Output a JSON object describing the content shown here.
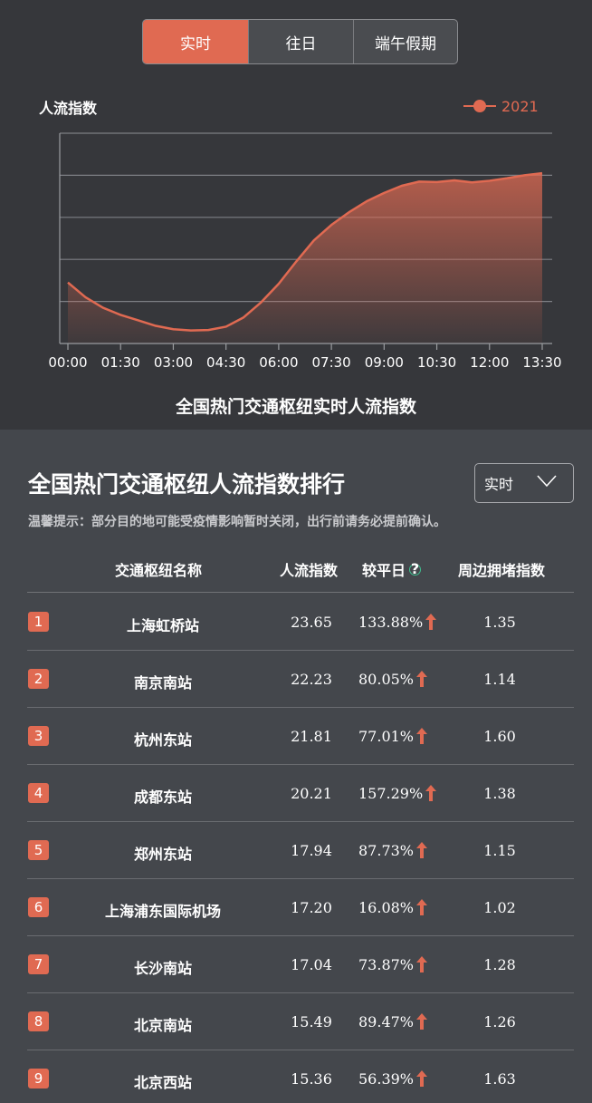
{
  "tabs": [
    {
      "label": "实时",
      "active": true
    },
    {
      "label": "往日",
      "active": false
    },
    {
      "label": "端午假期",
      "active": false
    }
  ],
  "chart_data": {
    "type": "area",
    "ylabel": "人流指数",
    "xlabel": "",
    "title": "全国热门交通枢纽实时人流指数",
    "legend": "top-right",
    "grid": true,
    "ylim": [
      0,
      5
    ],
    "series": [
      {
        "name": "2021",
        "color": "#e06a52",
        "x": [
          "00:00",
          "00:30",
          "01:00",
          "01:30",
          "02:00",
          "02:30",
          "03:00",
          "03:30",
          "04:00",
          "04:30",
          "05:00",
          "05:30",
          "06:00",
          "06:30",
          "07:00",
          "07:30",
          "08:00",
          "08:30",
          "09:00",
          "09:30",
          "10:00",
          "10:30",
          "11:00",
          "11:30",
          "12:00",
          "12:30",
          "13:00",
          "13:30"
        ],
        "values": [
          1.45,
          1.1,
          0.85,
          0.68,
          0.55,
          0.42,
          0.34,
          0.31,
          0.32,
          0.4,
          0.62,
          0.98,
          1.42,
          1.95,
          2.45,
          2.82,
          3.12,
          3.38,
          3.58,
          3.75,
          3.85,
          3.84,
          3.88,
          3.83,
          3.87,
          3.93,
          4.0,
          4.05
        ]
      }
    ],
    "xticks": [
      "00:00",
      "01:30",
      "03:00",
      "04:30",
      "06:00",
      "07:30",
      "09:00",
      "10:30",
      "12:00",
      "13:30"
    ]
  },
  "rank": {
    "title": "全国热门交通枢纽人流指数排行",
    "select_value": "实时",
    "tip": "温馨提示：部分目的地可能受疫情影响暂时关闭，出行前请务必提前确认。",
    "headers": {
      "name": "交通枢纽名称",
      "index": "人流指数",
      "compare": "较平日",
      "congestion": "周边拥堵指数"
    },
    "rows": [
      {
        "rank": "1",
        "name": "上海虹桥站",
        "index": "23.65",
        "compare": "133.88%",
        "congestion": "1.35"
      },
      {
        "rank": "2",
        "name": "南京南站",
        "index": "22.23",
        "compare": "80.05%",
        "congestion": "1.14"
      },
      {
        "rank": "3",
        "name": "杭州东站",
        "index": "21.81",
        "compare": "77.01%",
        "congestion": "1.60"
      },
      {
        "rank": "4",
        "name": "成都东站",
        "index": "20.21",
        "compare": "157.29%",
        "congestion": "1.38"
      },
      {
        "rank": "5",
        "name": "郑州东站",
        "index": "17.94",
        "compare": "87.73%",
        "congestion": "1.15"
      },
      {
        "rank": "6",
        "name": "上海浦东国际机场",
        "index": "17.20",
        "compare": "16.08%",
        "congestion": "1.02"
      },
      {
        "rank": "7",
        "name": "长沙南站",
        "index": "17.04",
        "compare": "73.87%",
        "congestion": "1.28"
      },
      {
        "rank": "8",
        "name": "北京南站",
        "index": "15.49",
        "compare": "89.47%",
        "congestion": "1.26"
      },
      {
        "rank": "9",
        "name": "北京西站",
        "index": "15.36",
        "compare": "56.39%",
        "congestion": "1.63"
      }
    ]
  }
}
